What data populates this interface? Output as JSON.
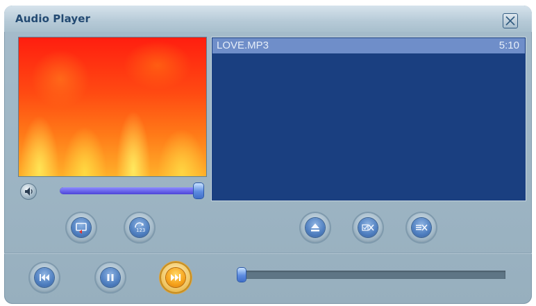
{
  "window": {
    "title": "Audio Player"
  },
  "playlist": {
    "items": [
      {
        "title": "LOVE.MP3",
        "duration": "5:10",
        "selected": true
      }
    ]
  },
  "volume": {
    "level": 1.0
  },
  "seek": {
    "position": 0.0
  },
  "buttons": {
    "speaker": "speaker-icon",
    "repeat": "repeat-icon",
    "shuffle": "shuffle-icon",
    "eject": "eject-icon",
    "remove_selected": "remove-selected-icon",
    "clear_list": "clear-list-icon",
    "previous": "previous-icon",
    "pause": "pause-icon",
    "next": "next-icon"
  },
  "colors": {
    "playlist_bg": "#1a3f80",
    "selected_row": "#6f8ec9",
    "title_text": "#234a72",
    "slider_fill": "#4c44d8",
    "next_button": "#f6a21b"
  }
}
